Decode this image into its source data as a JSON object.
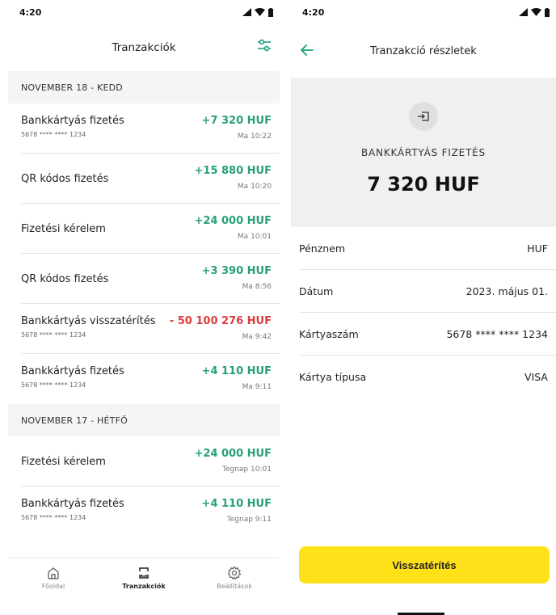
{
  "left": {
    "status": {
      "time": "4:20"
    },
    "header": {
      "title": "Tranzakciók",
      "filter_icon": "sliders-icon"
    },
    "sections": [
      {
        "title": "NOVEMBER 18 - KEDD",
        "items": [
          {
            "title": "Bankkártyás fizetés",
            "sub": "5678 **** **** 1234",
            "amount": "+7 320 HUF",
            "time": "Ma 10:22",
            "negative": false
          },
          {
            "title": "QR kódos fizetés",
            "sub": "",
            "amount": "+15 880 HUF",
            "time": "Ma 10:20",
            "negative": false
          },
          {
            "title": "Fizetési kérelem",
            "sub": "",
            "amount": "+24 000 HUF",
            "time": "Ma 10:01",
            "negative": false
          },
          {
            "title": "QR kódos fizetés",
            "sub": "",
            "amount": "+3 390 HUF",
            "time": "Ma 8:56",
            "negative": false
          },
          {
            "title": "Bankkártyás visszatérítés",
            "sub": "5678 **** **** 1234",
            "amount": "- 50 100 276 HUF",
            "time": "Ma 9:42",
            "negative": true
          },
          {
            "title": "Bankkártyás fizetés",
            "sub": "5678 **** **** 1234",
            "amount": "+4 110 HUF",
            "time": "Ma 9:11",
            "negative": false
          }
        ]
      },
      {
        "title": "NOVEMBER 17 - HÉTFŐ",
        "items": [
          {
            "title": "Fizetési kérelem",
            "sub": "",
            "amount": "+24 000 HUF",
            "time": "Tegnap 10:01",
            "negative": false
          },
          {
            "title": "Bankkártyás fizetés",
            "sub": "5678 **** **** 1234",
            "amount": "+4 110 HUF",
            "time": "Tegnap 9:11",
            "negative": false
          }
        ]
      }
    ],
    "nav": [
      {
        "label": "Főoldal",
        "icon": "home-icon",
        "active": false
      },
      {
        "label": "Tranzakciók",
        "icon": "transactions-icon",
        "active": true
      },
      {
        "label": "Beállítások",
        "icon": "gear-icon",
        "active": false
      }
    ]
  },
  "right": {
    "status": {
      "time": "4:20"
    },
    "header": {
      "title": "Tranzakció részletek",
      "back_icon": "arrow-left-icon"
    },
    "hero": {
      "icon": "card-payment-icon",
      "type": "BANKKÁRTYÁS FIZETÉS",
      "amount": "7 320 HUF"
    },
    "details": [
      {
        "label": "Pénznem",
        "value": "HUF"
      },
      {
        "label": "Dátum",
        "value": "2023. május 01."
      },
      {
        "label": "Kártyaszám",
        "value": "5678 **** **** 1234"
      },
      {
        "label": "Kártya típusa",
        "value": "VISA"
      }
    ],
    "refund_label": "Visszatérítés"
  },
  "colors": {
    "positive": "#27a07a",
    "negative": "#e03a3a",
    "accent": "#ffe11a"
  }
}
